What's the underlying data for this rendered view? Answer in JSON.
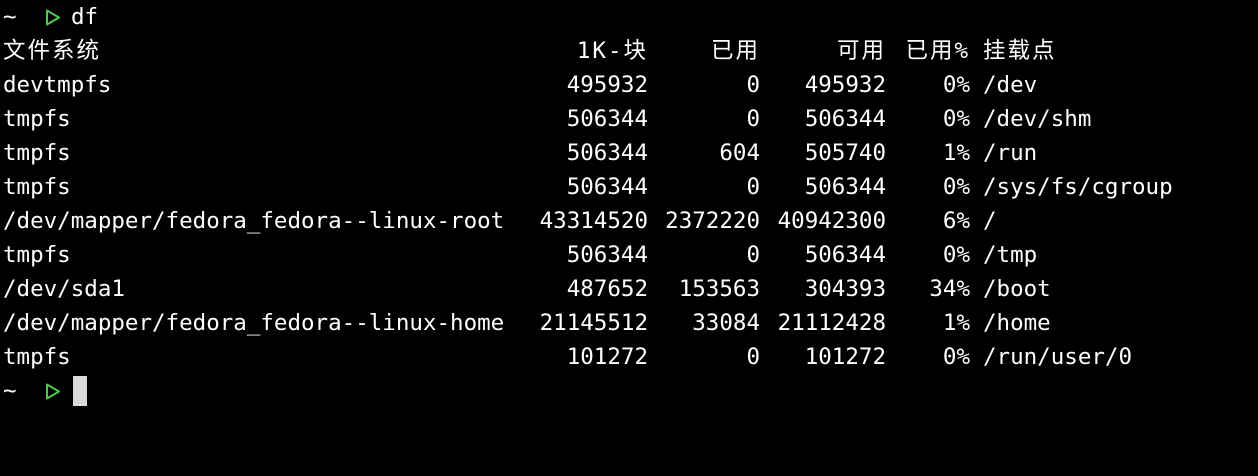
{
  "colors": {
    "background": "#000000",
    "text": "#ffffff",
    "prompt_arrow": "#4ec94e",
    "cursor": "#d9d9d9"
  },
  "prompt": {
    "tilde": "~",
    "arrow_icon": "prompt-arrow-icon",
    "command": "df"
  },
  "header": {
    "filesystem": "文件系统",
    "blocks": "1K-块",
    "used": "已用",
    "available": "可用",
    "use_pct": "已用%",
    "mounted_on": "挂载点"
  },
  "rows": [
    {
      "filesystem": "devtmpfs",
      "blocks": "495932",
      "used": "0",
      "available": "495932",
      "use_pct": "0%",
      "mounted_on": "/dev"
    },
    {
      "filesystem": "tmpfs",
      "blocks": "506344",
      "used": "0",
      "available": "506344",
      "use_pct": "0%",
      "mounted_on": "/dev/shm"
    },
    {
      "filesystem": "tmpfs",
      "blocks": "506344",
      "used": "604",
      "available": "505740",
      "use_pct": "1%",
      "mounted_on": "/run"
    },
    {
      "filesystem": "tmpfs",
      "blocks": "506344",
      "used": "0",
      "available": "506344",
      "use_pct": "0%",
      "mounted_on": "/sys/fs/cgroup"
    },
    {
      "filesystem": "/dev/mapper/fedora_fedora--linux-root",
      "blocks": "43314520",
      "used": "2372220",
      "available": "40942300",
      "use_pct": "6%",
      "mounted_on": "/"
    },
    {
      "filesystem": "tmpfs",
      "blocks": "506344",
      "used": "0",
      "available": "506344",
      "use_pct": "0%",
      "mounted_on": "/tmp"
    },
    {
      "filesystem": "/dev/sda1",
      "blocks": "487652",
      "used": "153563",
      "available": "304393",
      "use_pct": "34%",
      "mounted_on": "/boot"
    },
    {
      "filesystem": "/dev/mapper/fedora_fedora--linux-home",
      "blocks": "21145512",
      "used": "33084",
      "available": "21112428",
      "use_pct": "1%",
      "mounted_on": "/home"
    },
    {
      "filesystem": "tmpfs",
      "blocks": "101272",
      "used": "0",
      "available": "101272",
      "use_pct": "0%",
      "mounted_on": "/run/user/0"
    }
  ],
  "final_prompt": {
    "tilde": "~",
    "arrow_icon": "prompt-arrow-icon"
  }
}
